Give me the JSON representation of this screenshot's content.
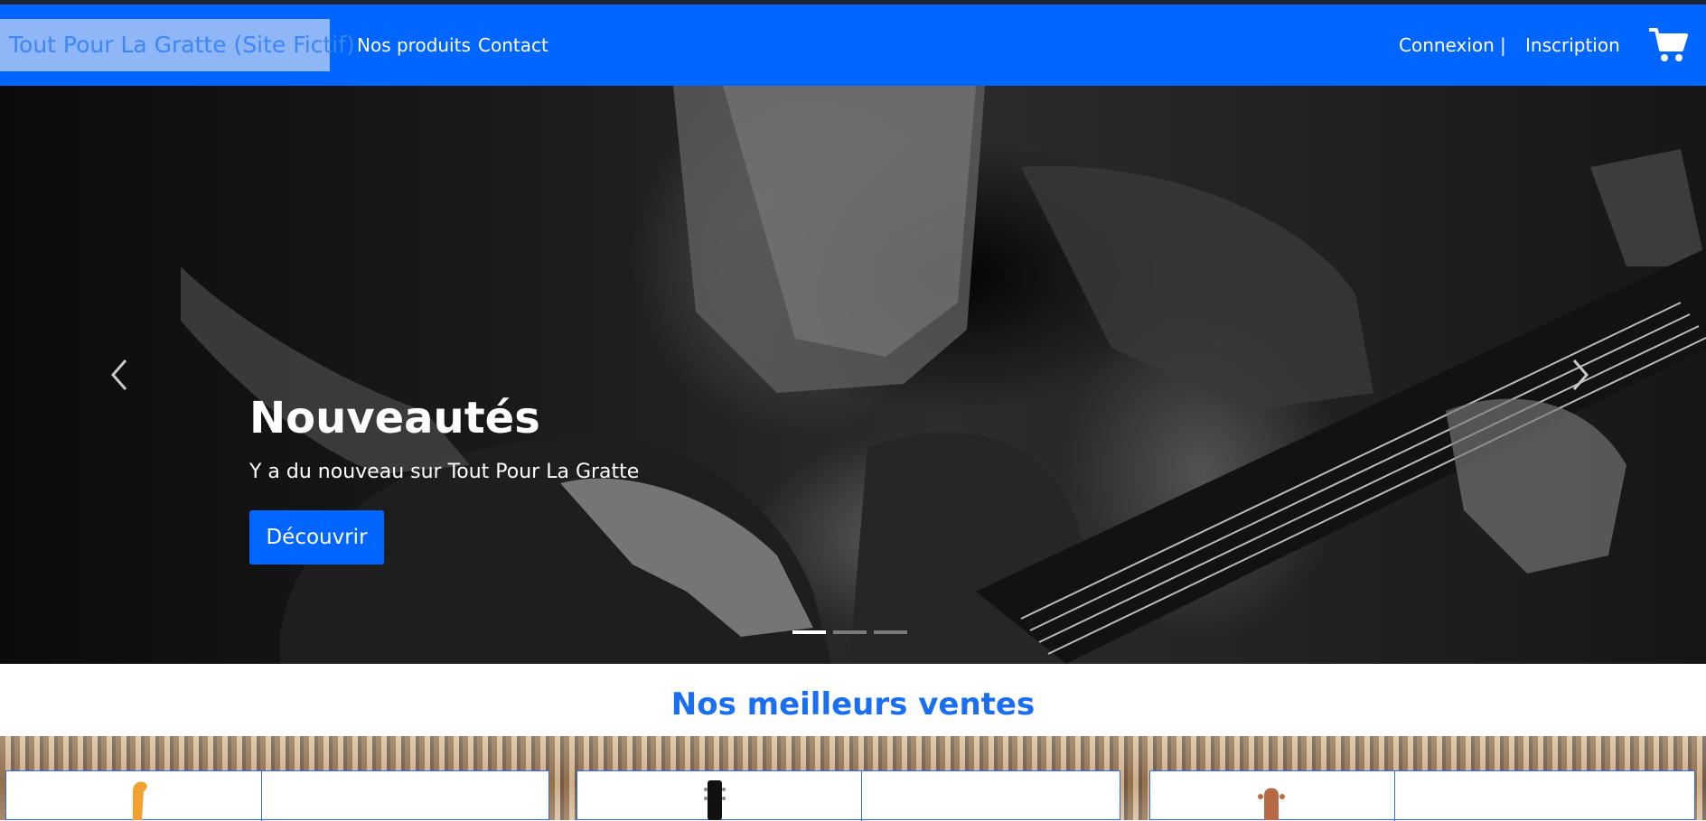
{
  "navbar": {
    "brand": "Tout Pour La Gratte (Site Fictif)",
    "links": [
      "Nos produits",
      "Contact"
    ],
    "auth": {
      "login": "Connexion",
      "separator": "|",
      "signup": "Inscription"
    },
    "cart_icon": "shopping-cart-icon",
    "color": "#0066ff"
  },
  "hero": {
    "title": "Nouveautés",
    "subtitle": "Y a du nouveau sur Tout Pour La Gratte",
    "button": "Découvrir",
    "slide_count": 3,
    "active_slide": 1,
    "prev_icon": "chevron-left-icon",
    "next_icon": "chevron-right-icon"
  },
  "best_sellers": {
    "title": "Nos meilleurs ventes",
    "title_color": "#1a6ef2"
  }
}
